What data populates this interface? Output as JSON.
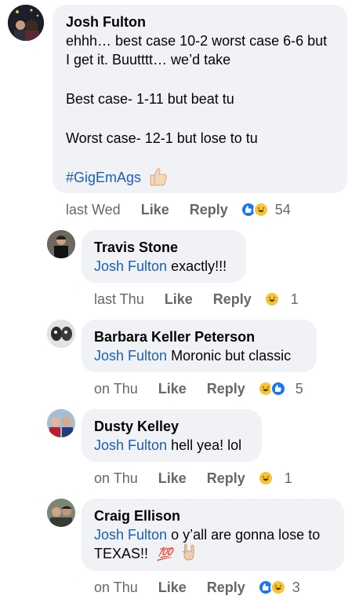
{
  "comments": [
    {
      "author": "Josh Fulton",
      "lines": [
        "ehhh… best case 10-2 worst case 6-6 but",
        "I get it.  Buutttt… we’d take",
        "",
        "Best case- 1-11 but beat tu",
        "",
        "Worst case- 12-1 but lose to tu",
        "",
        "#GigEmAgs"
      ],
      "time": "last Wed",
      "like": "Like",
      "reply": "Reply",
      "count": "54",
      "reactions": [
        "like",
        "haha"
      ]
    },
    {
      "author": "Travis Stone",
      "mention": "Josh Fulton",
      "text": "exactly!!!",
      "time": "last Thu",
      "like": "Like",
      "reply": "Reply",
      "count": "1",
      "reactions": [
        "haha"
      ]
    },
    {
      "author": "Barbara Keller Peterson",
      "mention": "Josh Fulton",
      "text": "Moronic but classic",
      "time": "on Thu",
      "like": "Like",
      "reply": "Reply",
      "count": "5",
      "reactions": [
        "haha",
        "like"
      ]
    },
    {
      "author": "Dusty Kelley",
      "mention": "Josh Fulton",
      "text": "hell yea! lol",
      "time": "on Thu",
      "like": "Like",
      "reply": "Reply",
      "count": "1",
      "reactions": [
        "haha"
      ]
    },
    {
      "author": "Craig Ellison",
      "mention": "Josh Fulton",
      "text": "o y’all are gonna lose to",
      "text2": "TEXAS!!",
      "emoji_100": "💯",
      "time": "on Thu",
      "like": "Like",
      "reply": "Reply",
      "count": "3",
      "reactions": [
        "like",
        "haha"
      ]
    }
  ],
  "colors": {
    "bubble": "#f0f2f5",
    "mention": "#1a5fb4",
    "meta": "#65676b",
    "like_blue": "#1877f2",
    "haha_yellow": "#f7c531"
  }
}
